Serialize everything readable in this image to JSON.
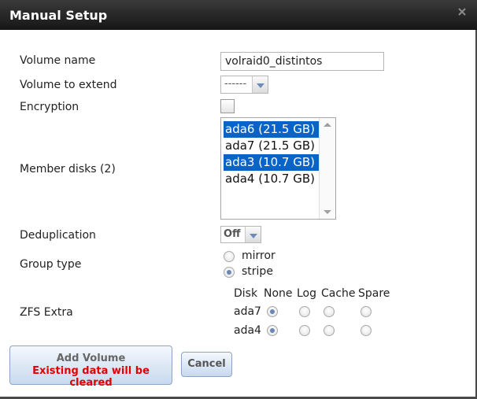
{
  "dialog": {
    "title": "Manual Setup",
    "close_icon": "close-icon"
  },
  "form": {
    "volume_name": {
      "label": "Volume name",
      "value": "volraid0_distintos"
    },
    "volume_to_extend": {
      "label": "Volume to extend",
      "value": "------"
    },
    "encryption": {
      "label": "Encryption",
      "checked": false
    },
    "member_disks": {
      "label": "Member disks (2)",
      "options": [
        {
          "text": "ada6 (21.5 GB)",
          "selected": true
        },
        {
          "text": "ada7 (21.5 GB)",
          "selected": false
        },
        {
          "text": "ada3 (10.7 GB)",
          "selected": true
        },
        {
          "text": "ada4 (10.7 GB)",
          "selected": false
        }
      ]
    },
    "deduplication": {
      "label": "Deduplication",
      "value": "Off"
    },
    "group_type": {
      "label": "Group type",
      "options": [
        {
          "text": "mirror",
          "selected": false
        },
        {
          "text": "stripe",
          "selected": true
        }
      ]
    },
    "zfs_extra": {
      "label": "ZFS Extra",
      "headers": [
        "Disk",
        "None",
        "Log",
        "Cache",
        "Spare"
      ],
      "rows": [
        {
          "disk": "ada7",
          "selected": "None"
        },
        {
          "disk": "ada4",
          "selected": "None"
        }
      ]
    }
  },
  "buttons": {
    "add_volume": "Add Volume",
    "add_warning": "Existing data will be cleared",
    "cancel": "Cancel"
  },
  "colors": {
    "selection": "#0a64c8",
    "warning": "#e00000",
    "title_bar": "#1c1c1c"
  }
}
